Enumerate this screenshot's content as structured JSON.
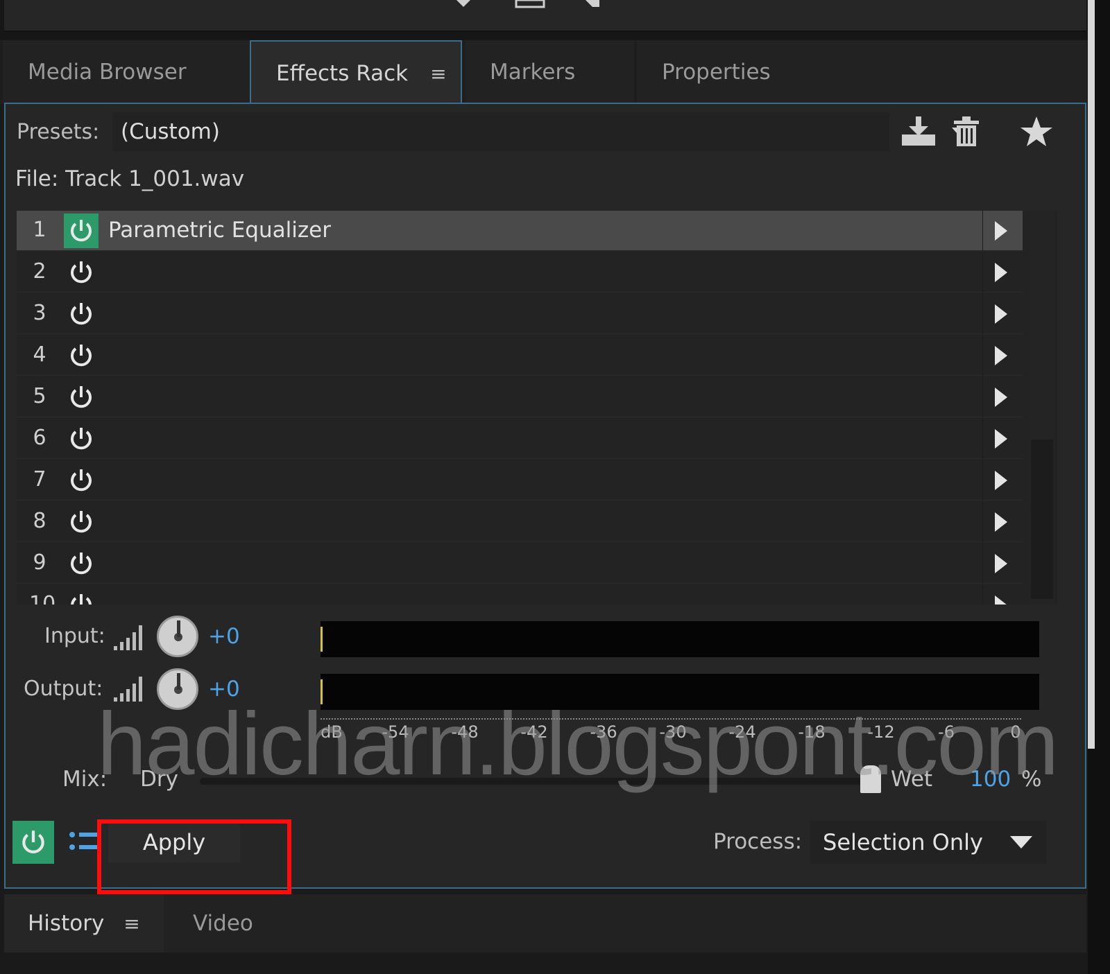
{
  "tabs": [
    {
      "label": "Media Browser"
    },
    {
      "label": "Effects Rack",
      "active": true
    },
    {
      "label": "Markers"
    },
    {
      "label": "Properties"
    }
  ],
  "presets": {
    "label": "Presets:",
    "value": "(Custom)"
  },
  "file": {
    "label": "File: Track 1_001.wav"
  },
  "rack": {
    "slots": [
      {
        "num": "1",
        "name": "Parametric Equalizer",
        "on": true
      },
      {
        "num": "2",
        "name": ""
      },
      {
        "num": "3",
        "name": ""
      },
      {
        "num": "4",
        "name": ""
      },
      {
        "num": "5",
        "name": ""
      },
      {
        "num": "6",
        "name": ""
      },
      {
        "num": "7",
        "name": ""
      },
      {
        "num": "8",
        "name": ""
      },
      {
        "num": "9",
        "name": ""
      },
      {
        "num": "10",
        "name": ""
      }
    ]
  },
  "levels": {
    "input_label": "Input:",
    "input_value": "+0",
    "output_label": "Output:",
    "output_value": "+0"
  },
  "scale_ticks": [
    "dB",
    "-54",
    "-48",
    "-42",
    "-36",
    "-30",
    "-24",
    "-18",
    "-12",
    "-6",
    "0"
  ],
  "mix": {
    "label": "Mix:",
    "dry": "Dry",
    "wet": "Wet",
    "value": "100",
    "unit": "%"
  },
  "apply": {
    "label": "Apply"
  },
  "process": {
    "label": "Process:",
    "value": "Selection Only"
  },
  "history_tabs": [
    {
      "label": "History"
    },
    {
      "label": "Video"
    }
  ],
  "watermark": "hadicharn.blogspont.com",
  "colors": {
    "accent": "#2d9a6a",
    "value_blue": "#4da3e6",
    "highlight": "#ff0c0c",
    "panel_border": "#3d6d8c"
  }
}
